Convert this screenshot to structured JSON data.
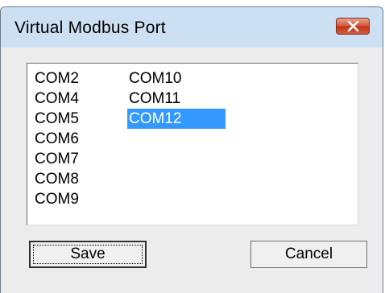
{
  "window": {
    "title": "Virtual Modbus Port",
    "close_icon": "close-icon"
  },
  "port_list": {
    "columns": [
      [
        "COM2",
        "COM4",
        "COM5",
        "COM6",
        "COM7",
        "COM8",
        "COM9"
      ],
      [
        "COM10",
        "COM11",
        "COM12"
      ]
    ],
    "selected": "COM12"
  },
  "buttons": {
    "save_label": "Save",
    "cancel_label": "Cancel"
  },
  "colors": {
    "selection": "#3399ff",
    "close_button": "#c23418"
  }
}
